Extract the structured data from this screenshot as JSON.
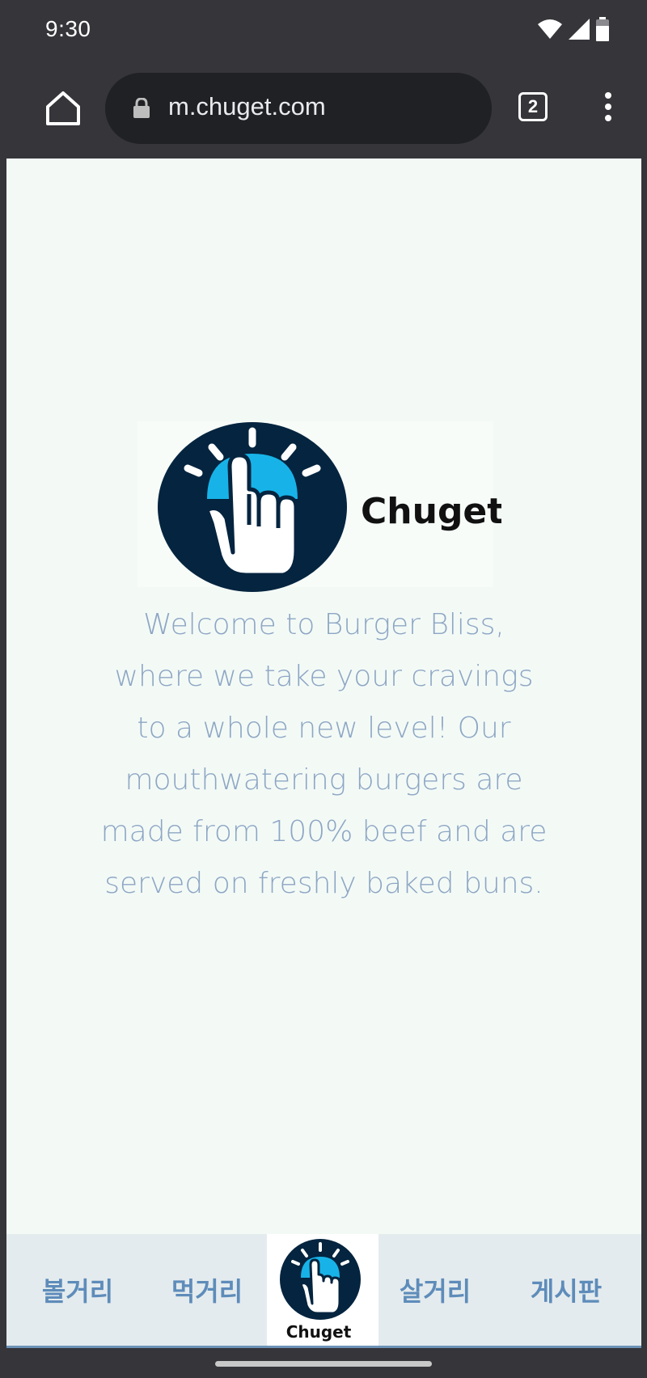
{
  "status_bar": {
    "time": "9:30"
  },
  "browser": {
    "url": "m.chuget.com",
    "tab_count": "2"
  },
  "logo": {
    "wordmark": "Chuget"
  },
  "main": {
    "welcome_text": "Welcome to Burger Bliss, where we take your cravings to a whole new level! Our mouthwatering burgers are made from 100% beef and are served on freshly baked buns."
  },
  "bottom_nav": {
    "items": [
      "볼거리",
      "먹거리",
      "살거리",
      "게시판"
    ],
    "center_logo_text": "Chuget"
  },
  "colors": {
    "brand_navy": "#04243f",
    "brand_blue": "#17b3e8",
    "text_muted_blue": "#8ea6c4",
    "nav_text": "#5e8cba"
  },
  "icons": [
    "wifi-icon",
    "signal-icon",
    "battery-icon",
    "home-icon",
    "lock-icon",
    "tabs-icon",
    "more-vert-icon",
    "pointer-hand-icon"
  ]
}
